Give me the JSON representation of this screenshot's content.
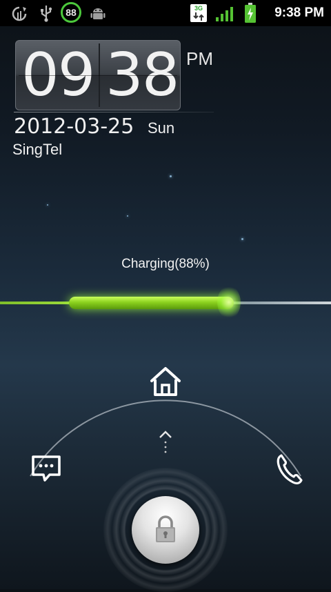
{
  "status_bar": {
    "time": "9:38 PM",
    "battery_badge": "88",
    "network_type": "3G",
    "icons": [
      "sync-icon",
      "usb-icon",
      "battery-percent-icon",
      "android-debug-icon",
      "data-transfer-icon",
      "signal-icon",
      "battery-charging-icon"
    ]
  },
  "clock": {
    "hours": "09",
    "minutes": "38",
    "ampm": "PM",
    "date": "2012-03-25",
    "weekday": "Sun",
    "carrier": "SingTel"
  },
  "charging": {
    "label": "Charging(88%)",
    "level": 0.88
  },
  "unlock": {
    "targets": [
      "home-icon",
      "message-icon",
      "phone-icon",
      "lock-icon"
    ]
  },
  "colors": {
    "accent_green": "#8cd21f",
    "status_green": "#55c233"
  }
}
